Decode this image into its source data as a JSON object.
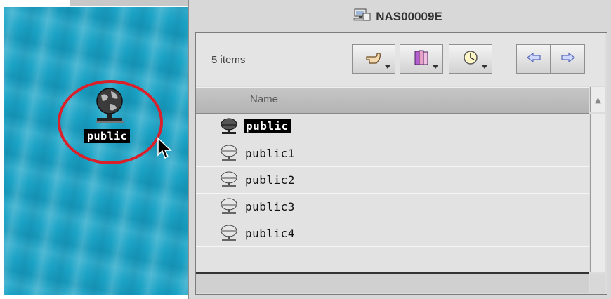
{
  "desktop": {
    "icon_label": "public"
  },
  "window": {
    "title": "NAS00009E",
    "item_count": "5 items",
    "toolbar": {
      "buttons": [
        "pointing-hand-icon",
        "books-icon",
        "clock-icon"
      ],
      "nav": [
        "back-arrow-icon",
        "forward-arrow-icon"
      ]
    },
    "column_header": "Name",
    "items": [
      {
        "label": "public",
        "selected": true
      },
      {
        "label": "public1",
        "selected": false
      },
      {
        "label": "public2",
        "selected": false
      },
      {
        "label": "public3",
        "selected": false
      },
      {
        "label": "public4",
        "selected": false
      }
    ]
  },
  "colors": {
    "desktop_bg": "#1aa3c6",
    "highlight_ring": "#d9202b",
    "selection": "#000000"
  }
}
